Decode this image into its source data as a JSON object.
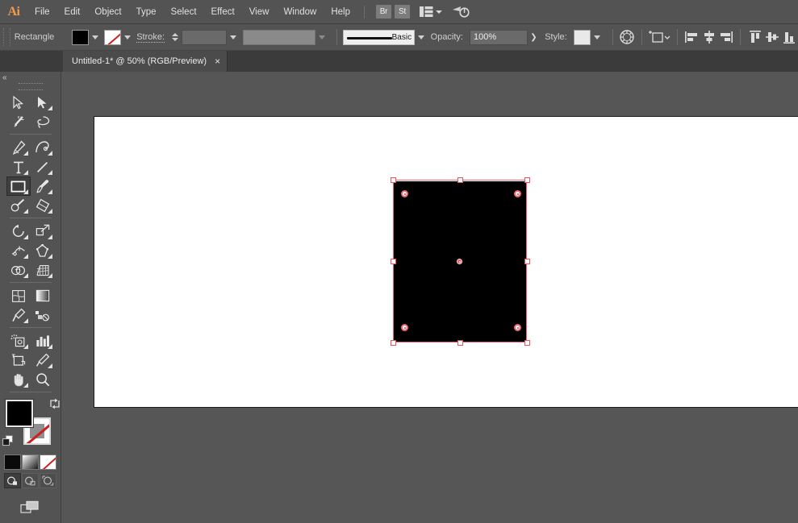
{
  "app": {
    "name": "Adobe Illustrator",
    "logo_text": "Ai",
    "logo_color": "#f09b4a"
  },
  "menubar": {
    "items": [
      {
        "label": "File"
      },
      {
        "label": "Edit"
      },
      {
        "label": "Object"
      },
      {
        "label": "Type"
      },
      {
        "label": "Select"
      },
      {
        "label": "Effect"
      },
      {
        "label": "View"
      },
      {
        "label": "Window"
      },
      {
        "label": "Help"
      }
    ],
    "right_buttons": [
      {
        "label": "Br",
        "name": "bridge-button"
      },
      {
        "label": "St",
        "name": "stock-button"
      }
    ],
    "workspace_switcher": {
      "icon": "workspace-icon",
      "chevron": "chevron-down-icon"
    },
    "search_icon": "search-adobe-icon"
  },
  "controlbar": {
    "selection_label": "Rectangle",
    "fill": {
      "label": "Fill",
      "color": "#000000",
      "icon": "fill-swatch"
    },
    "stroke_swatch": {
      "label": "Stroke",
      "color": "none",
      "icon": "stroke-none-swatch"
    },
    "stroke_label": "Stroke:",
    "stroke_weight_value": "",
    "stroke_weight_placeholder": "",
    "variable_width_value": "",
    "brush_definition": "Basic",
    "opacity_label": "Opacity:",
    "opacity_value": "100%",
    "opacity_more": "❯",
    "style_label": "Style:",
    "style_swatch_color": "#e9e9e9",
    "icons": [
      {
        "name": "recolor-artwork-icon"
      },
      {
        "name": "transform-shape-icon"
      },
      {
        "name": "align-left-icon"
      },
      {
        "name": "align-horizontal-center-icon"
      },
      {
        "name": "align-right-icon"
      },
      {
        "name": "align-top-icon"
      },
      {
        "name": "align-vertical-center-icon"
      },
      {
        "name": "align-bottom-icon"
      }
    ]
  },
  "tabbar": {
    "tabs": [
      {
        "title": "Untitled-1* @ 50% (RGB/Preview)",
        "close": "×",
        "active": true
      }
    ]
  },
  "toolbar": {
    "collapse_label": "«",
    "tools": [
      {
        "name": "tool-selection",
        "label": "Selection",
        "has_flyout": false,
        "selected": false
      },
      {
        "name": "tool-direct-selection",
        "label": "Direct Selection",
        "has_flyout": true,
        "selected": false
      },
      {
        "name": "tool-magic-wand",
        "label": "Magic Wand",
        "has_flyout": false,
        "selected": false
      },
      {
        "name": "tool-lasso",
        "label": "Lasso",
        "has_flyout": false,
        "selected": false
      },
      {
        "name": "tool-pen",
        "label": "Pen",
        "has_flyout": true,
        "selected": false
      },
      {
        "name": "tool-curvature",
        "label": "Curvature",
        "has_flyout": true,
        "selected": false
      },
      {
        "name": "tool-type",
        "label": "Type",
        "has_flyout": true,
        "selected": false
      },
      {
        "name": "tool-line-segment",
        "label": "Line Segment",
        "has_flyout": true,
        "selected": false
      },
      {
        "name": "tool-rectangle",
        "label": "Rectangle",
        "has_flyout": true,
        "selected": true
      },
      {
        "name": "tool-paintbrush",
        "label": "Paintbrush",
        "has_flyout": true,
        "selected": false
      },
      {
        "name": "tool-shaper",
        "label": "Shaper",
        "has_flyout": true,
        "selected": false
      },
      {
        "name": "tool-eraser",
        "label": "Eraser",
        "has_flyout": true,
        "selected": false
      },
      {
        "name": "tool-rotate",
        "label": "Rotate",
        "has_flyout": true,
        "selected": false
      },
      {
        "name": "tool-scale",
        "label": "Scale",
        "has_flyout": true,
        "selected": false
      },
      {
        "name": "tool-width",
        "label": "Width",
        "has_flyout": true,
        "selected": false
      },
      {
        "name": "tool-free-transform",
        "label": "Free Transform",
        "has_flyout": true,
        "selected": false
      },
      {
        "name": "tool-shape-builder",
        "label": "Shape Builder",
        "has_flyout": true,
        "selected": false
      },
      {
        "name": "tool-perspective-grid",
        "label": "Perspective Grid",
        "has_flyout": true,
        "selected": false
      },
      {
        "name": "tool-mesh",
        "label": "Mesh",
        "has_flyout": false,
        "selected": false
      },
      {
        "name": "tool-gradient",
        "label": "Gradient",
        "has_flyout": false,
        "selected": false
      },
      {
        "name": "tool-eyedropper",
        "label": "Eyedropper",
        "has_flyout": true,
        "selected": false
      },
      {
        "name": "tool-blend",
        "label": "Blend",
        "has_flyout": false,
        "selected": false
      },
      {
        "name": "tool-symbol-sprayer",
        "label": "Symbol Sprayer",
        "has_flyout": true,
        "selected": false
      },
      {
        "name": "tool-column-graph",
        "label": "Column Graph",
        "has_flyout": true,
        "selected": false
      },
      {
        "name": "tool-artboard",
        "label": "Artboard",
        "has_flyout": false,
        "selected": false
      },
      {
        "name": "tool-slice",
        "label": "Slice",
        "has_flyout": true,
        "selected": false
      },
      {
        "name": "tool-hand",
        "label": "Hand",
        "has_flyout": true,
        "selected": false
      },
      {
        "name": "tool-zoom",
        "label": "Zoom",
        "has_flyout": false,
        "selected": false
      }
    ],
    "fill_stroke": {
      "fill_color": "#000000",
      "fill_label": "Fill",
      "stroke_label": "Stroke",
      "stroke_color": "none",
      "swap_icon": "swap-fill-stroke-icon",
      "default_icon": "default-fill-stroke-icon"
    },
    "paint_modes": [
      {
        "name": "color-mode-button",
        "label": "Color",
        "style": "black"
      },
      {
        "name": "gradient-mode-button",
        "label": "Gradient",
        "style": "grad"
      },
      {
        "name": "none-mode-button",
        "label": "None",
        "style": "none"
      }
    ],
    "draw_modes": [
      {
        "name": "draw-normal-button",
        "label": "Draw Normal",
        "active": true
      },
      {
        "name": "draw-behind-button",
        "label": "Draw Behind",
        "active": false
      },
      {
        "name": "draw-inside-button",
        "label": "Draw Inside",
        "active": false
      }
    ],
    "screen_mode": {
      "name": "change-screen-mode-button",
      "label": "Change Screen Mode"
    }
  },
  "canvas": {
    "background_color": "#565656",
    "artboard_color": "#ffffff",
    "zoom_level": "50%",
    "color_mode": "RGB",
    "view_mode": "Preview",
    "selection": {
      "type": "rectangle",
      "fill_color": "#000000",
      "stroke": "none",
      "selection_color": "#f4626b",
      "handles": 8,
      "corner_widgets": 4,
      "center_point": true
    }
  }
}
